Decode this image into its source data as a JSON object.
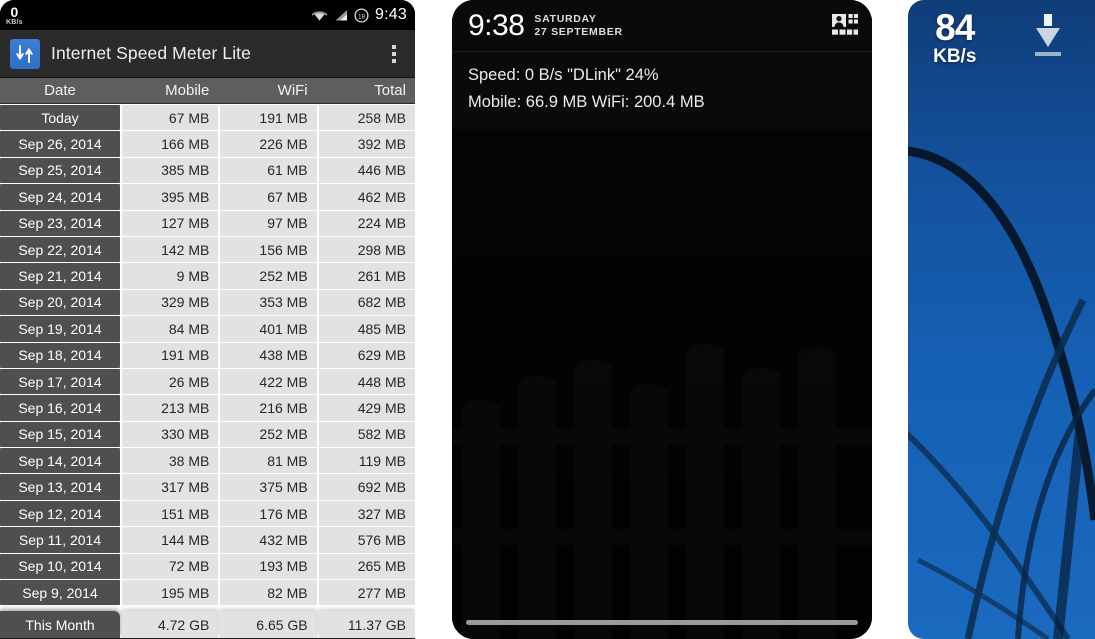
{
  "panel_app": {
    "status_bar": {
      "speed_value": "0",
      "speed_unit": "KB/s",
      "wifi_icon": "wifi-icon",
      "signal_icon": "cellular-signal-icon",
      "battery_icon": "battery-circle-icon",
      "clock": "9:43"
    },
    "app_bar": {
      "icon": "speed-meter-app-icon",
      "title": "Internet Speed Meter Lite",
      "overflow_icon": "overflow-menu-icon"
    },
    "table": {
      "columns": [
        "Date",
        "Mobile",
        "WiFi",
        "Total"
      ],
      "rows": [
        {
          "date": "Today",
          "mobile": "67 MB",
          "wifi": "191 MB",
          "total": "258 MB"
        },
        {
          "date": "Sep 26, 2014",
          "mobile": "166 MB",
          "wifi": "226 MB",
          "total": "392 MB"
        },
        {
          "date": "Sep 25, 2014",
          "mobile": "385 MB",
          "wifi": "61 MB",
          "total": "446 MB"
        },
        {
          "date": "Sep 24, 2014",
          "mobile": "395 MB",
          "wifi": "67 MB",
          "total": "462 MB"
        },
        {
          "date": "Sep 23, 2014",
          "mobile": "127 MB",
          "wifi": "97 MB",
          "total": "224 MB"
        },
        {
          "date": "Sep 22, 2014",
          "mobile": "142 MB",
          "wifi": "156 MB",
          "total": "298 MB"
        },
        {
          "date": "Sep 21, 2014",
          "mobile": "9 MB",
          "wifi": "252 MB",
          "total": "261 MB"
        },
        {
          "date": "Sep 20, 2014",
          "mobile": "329 MB",
          "wifi": "353 MB",
          "total": "682 MB"
        },
        {
          "date": "Sep 19, 2014",
          "mobile": "84 MB",
          "wifi": "401 MB",
          "total": "485 MB"
        },
        {
          "date": "Sep 18, 2014",
          "mobile": "191 MB",
          "wifi": "438 MB",
          "total": "629 MB"
        },
        {
          "date": "Sep 17, 2014",
          "mobile": "26 MB",
          "wifi": "422 MB",
          "total": "448 MB"
        },
        {
          "date": "Sep 16, 2014",
          "mobile": "213 MB",
          "wifi": "216 MB",
          "total": "429 MB"
        },
        {
          "date": "Sep 15, 2014",
          "mobile": "330 MB",
          "wifi": "252 MB",
          "total": "582 MB"
        },
        {
          "date": "Sep 14, 2014",
          "mobile": "38 MB",
          "wifi": "81 MB",
          "total": "119 MB"
        },
        {
          "date": "Sep 13, 2014",
          "mobile": "317 MB",
          "wifi": "375 MB",
          "total": "692 MB"
        },
        {
          "date": "Sep 12, 2014",
          "mobile": "151 MB",
          "wifi": "176 MB",
          "total": "327 MB"
        },
        {
          "date": "Sep 11, 2014",
          "mobile": "144 MB",
          "wifi": "432 MB",
          "total": "576 MB"
        },
        {
          "date": "Sep 10, 2014",
          "mobile": "72 MB",
          "wifi": "193 MB",
          "total": "265 MB"
        },
        {
          "date": "Sep 9, 2014",
          "mobile": "195 MB",
          "wifi": "82 MB",
          "total": "277 MB"
        }
      ],
      "summary": {
        "date": "This Month",
        "mobile": "4.72 GB",
        "wifi": "6.65 GB",
        "total": "11.37 GB"
      }
    }
  },
  "panel_notification": {
    "clock": "9:38",
    "day": "SATURDAY",
    "date": "27 SEPTEMBER",
    "quick_settings_icon": "quick-settings-grid-icon",
    "notification": {
      "line1": "Speed: 0 B/s   \"DLink\" 24%",
      "line2": "Mobile: 66.9 MB   WiFi: 200.4 MB"
    }
  },
  "panel_home": {
    "speed_value": "84",
    "speed_unit": "KB/s",
    "download_icon": "download-arrow-icon"
  },
  "theme": {
    "app_bar_bg": "#2b2b2b",
    "header_bg": "#5e5e5e",
    "date_cell_bg": "#4f4f4f",
    "value_cell_bg": "#e2e2e2",
    "accent_blue": "#3d7fd6",
    "home_blue": "#1560b4"
  }
}
